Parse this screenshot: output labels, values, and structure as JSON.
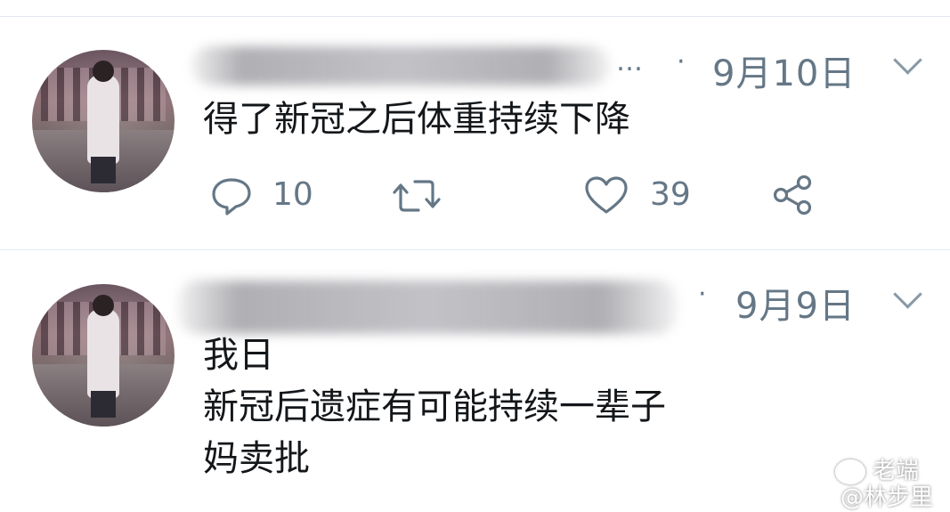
{
  "tweets": [
    {
      "date": "9月10日",
      "ellipsis": "…",
      "separator": "·",
      "lines": [
        "得了新冠之后体重持续下降"
      ],
      "reply_count": "10",
      "like_count": "39"
    },
    {
      "date": "9月9日",
      "separator": "·",
      "lines": [
        "我日",
        "新冠后遗症有可能持续一辈子",
        "妈卖批"
      ]
    }
  ],
  "watermark": {
    "line1": "老端",
    "line2": "@林步里"
  },
  "colors": {
    "text": "#14171a",
    "secondary": "#657786",
    "divider": "#e1e8ed"
  }
}
